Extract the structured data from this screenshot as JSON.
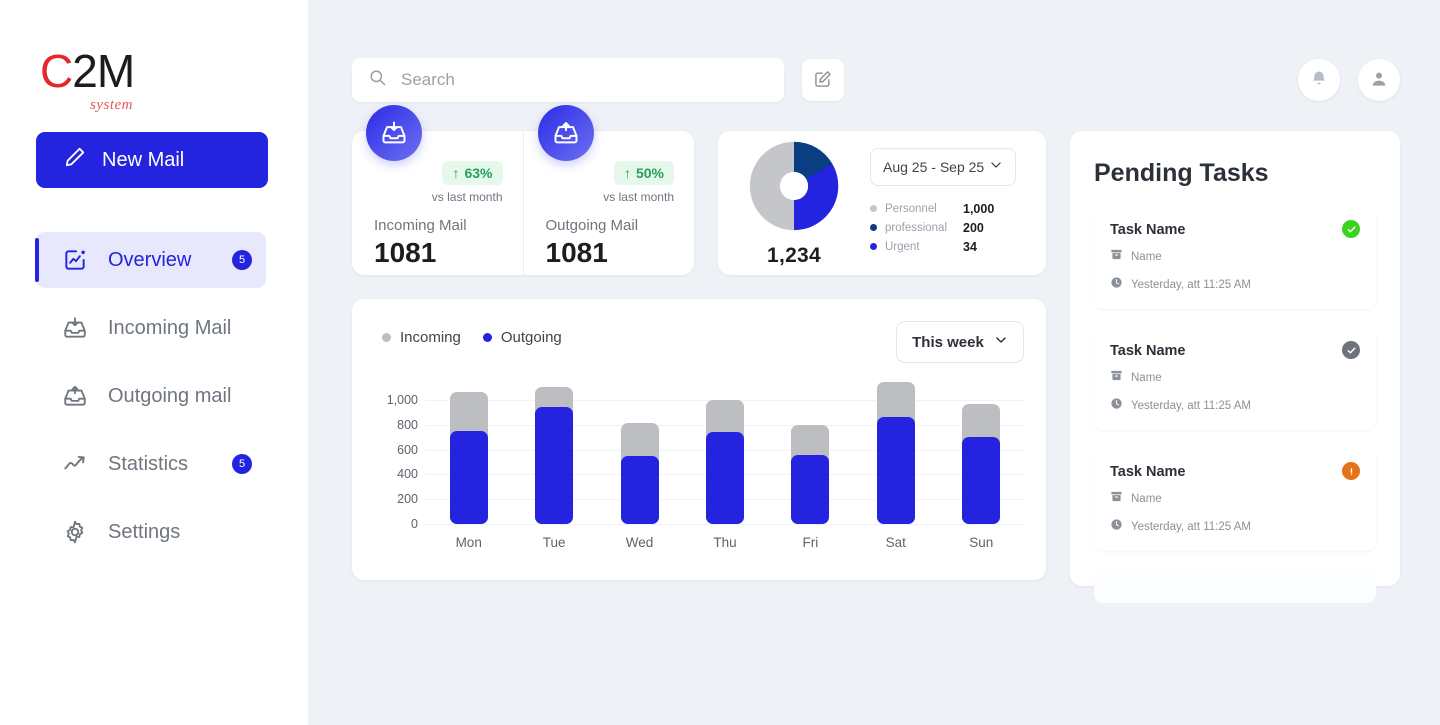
{
  "brand": {
    "logo_c": "C",
    "logo_2m": "2M",
    "logo_sub": "system",
    "color_red": "#e8252a",
    "color_primary": "#2323e0"
  },
  "sidebar": {
    "new_mail_label": "New Mail",
    "items": [
      {
        "label": "Overview",
        "icon": "chart-square-icon",
        "badge": "5",
        "active": true
      },
      {
        "label": "Incoming Mail",
        "icon": "inbox-download-icon",
        "badge": "",
        "active": false
      },
      {
        "label": "Outgoing mail",
        "icon": "inbox-upload-icon",
        "badge": "",
        "active": false
      },
      {
        "label": "Statistics",
        "icon": "trend-up-icon",
        "badge": "5",
        "active": false
      },
      {
        "label": "Settings",
        "icon": "gear-icon",
        "badge": "",
        "active": false
      }
    ]
  },
  "topbar": {
    "search_placeholder": "Search",
    "search_value": "",
    "compose_icon": "compose-square-icon",
    "notification_icon": "bell-icon",
    "profile_icon": "user-icon"
  },
  "stats": [
    {
      "icon": "inbox-download-icon",
      "delta": "63%",
      "delta_arrow": "↑",
      "delta_sub": "vs last month",
      "label": "Incoming Mail",
      "value": "1081"
    },
    {
      "icon": "inbox-upload-icon",
      "delta": "50%",
      "delta_arrow": "↑",
      "delta_sub": "vs last month",
      "label": "Outgoing Mail",
      "value": "1081"
    }
  ],
  "donut": {
    "date_range": "Aug 25 - Sep 25",
    "total": "1,234",
    "legend": [
      {
        "name": "Personnel",
        "value": "1,000",
        "color": "#c4c6ca"
      },
      {
        "name": "professional",
        "value": "200",
        "color": "#0b3d82"
      },
      {
        "name": "Urgent",
        "value": "34",
        "color": "#2323e0"
      }
    ]
  },
  "chart_data": {
    "type": "bar",
    "title": "",
    "xlabel": "",
    "ylabel": "",
    "ylim": [
      0,
      1200
    ],
    "grid": true,
    "legend_position": "top-left",
    "stacked": true,
    "range_label": "This week",
    "categories": [
      "Mon",
      "Tue",
      "Wed",
      "Thu",
      "Fri",
      "Sat",
      "Sun"
    ],
    "y_ticks": [
      "0",
      "200",
      "400",
      "600",
      "800",
      "1,000"
    ],
    "y_tick_values": [
      0,
      200,
      400,
      600,
      800,
      1000
    ],
    "series": [
      {
        "name": "Incoming",
        "color": "#bcbec2",
        "values": [
          1060,
          1105,
          810,
          1000,
          800,
          1140,
          970
        ]
      },
      {
        "name": "Outgoing",
        "color": "#2323e0",
        "values": [
          750,
          940,
          550,
          745,
          555,
          860,
          700
        ]
      }
    ]
  },
  "tasks": {
    "title": "Pending Tasks",
    "items": [
      {
        "name": "Task Name",
        "meta_name": "Name",
        "meta_time": "Yesterday, att 11:25 AM",
        "status": "done",
        "status_color": "#3ad420",
        "status_icon": "check-circle-icon"
      },
      {
        "name": "Task Name",
        "meta_name": "Name",
        "meta_time": "Yesterday, att 11:25 AM",
        "status": "completed-muted",
        "status_color": "#6e7378",
        "status_icon": "check-circle-icon"
      },
      {
        "name": "Task Name",
        "meta_name": "Name",
        "meta_time": "Yesterday, att 11:25 AM",
        "status": "urgent",
        "status_color": "#e5721b",
        "status_icon": "alert-circle-icon"
      }
    ]
  }
}
